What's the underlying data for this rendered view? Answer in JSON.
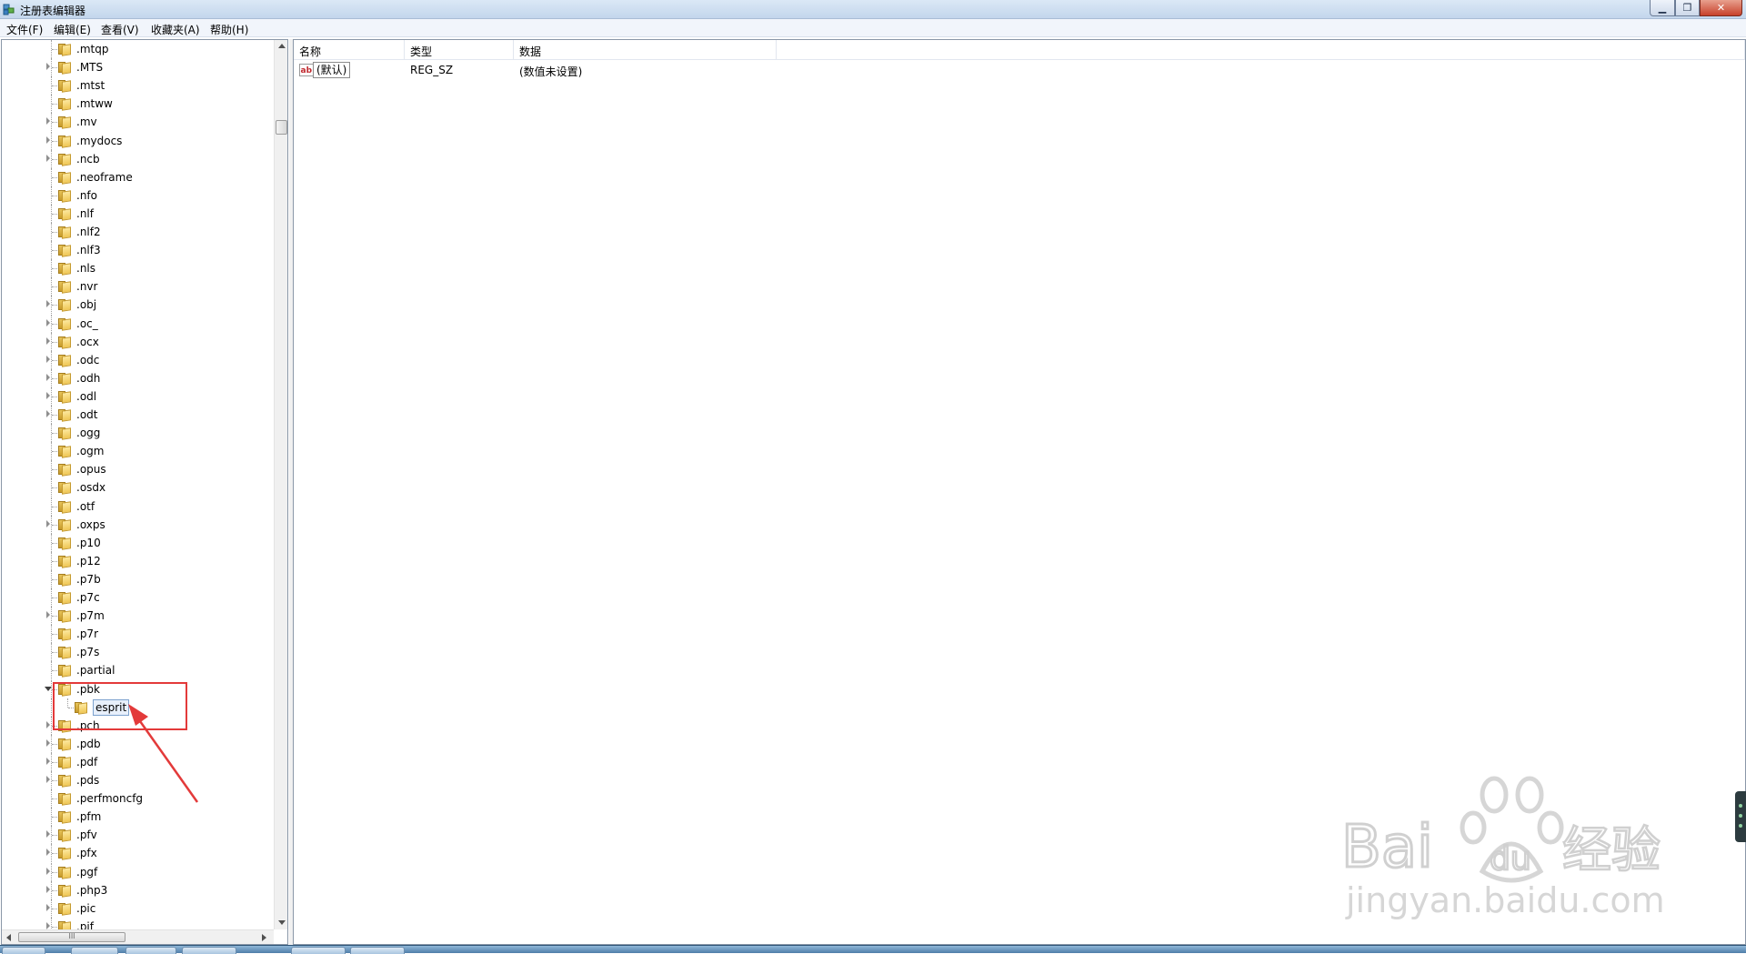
{
  "window": {
    "title": "注册表编辑器"
  },
  "menu": [
    "文件(F)",
    "编辑(E)",
    "查看(V)",
    "收藏夹(A)",
    "帮助(H)"
  ],
  "tree": {
    "items": [
      {
        "label": ".mtqp",
        "expander": false
      },
      {
        "label": ".MTS",
        "expander": true
      },
      {
        "label": ".mtst",
        "expander": false
      },
      {
        "label": ".mtww",
        "expander": false
      },
      {
        "label": ".mv",
        "expander": true
      },
      {
        "label": ".mydocs",
        "expander": true
      },
      {
        "label": ".ncb",
        "expander": true
      },
      {
        "label": ".neoframe",
        "expander": false
      },
      {
        "label": ".nfo",
        "expander": false
      },
      {
        "label": ".nlf",
        "expander": false
      },
      {
        "label": ".nlf2",
        "expander": false
      },
      {
        "label": ".nlf3",
        "expander": false
      },
      {
        "label": ".nls",
        "expander": false
      },
      {
        "label": ".nvr",
        "expander": false
      },
      {
        "label": ".obj",
        "expander": true
      },
      {
        "label": ".oc_",
        "expander": true
      },
      {
        "label": ".ocx",
        "expander": true
      },
      {
        "label": ".odc",
        "expander": true
      },
      {
        "label": ".odh",
        "expander": true
      },
      {
        "label": ".odl",
        "expander": true
      },
      {
        "label": ".odt",
        "expander": true
      },
      {
        "label": ".ogg",
        "expander": false
      },
      {
        "label": ".ogm",
        "expander": false
      },
      {
        "label": ".opus",
        "expander": false
      },
      {
        "label": ".osdx",
        "expander": false
      },
      {
        "label": ".otf",
        "expander": false
      },
      {
        "label": ".oxps",
        "expander": true
      },
      {
        "label": ".p10",
        "expander": false
      },
      {
        "label": ".p12",
        "expander": false
      },
      {
        "label": ".p7b",
        "expander": false
      },
      {
        "label": ".p7c",
        "expander": false
      },
      {
        "label": ".p7m",
        "expander": true
      },
      {
        "label": ".p7r",
        "expander": false
      },
      {
        "label": ".p7s",
        "expander": false
      },
      {
        "label": ".partial",
        "expander": false
      },
      {
        "label": ".pbk",
        "expander": "open"
      },
      {
        "label": "esprit",
        "expander": false,
        "child": true,
        "selected": true
      },
      {
        "label": ".pch",
        "expander": true
      },
      {
        "label": ".pdb",
        "expander": true
      },
      {
        "label": ".pdf",
        "expander": true
      },
      {
        "label": ".pds",
        "expander": true
      },
      {
        "label": ".perfmoncfg",
        "expander": false
      },
      {
        "label": ".pfm",
        "expander": false
      },
      {
        "label": ".pfv",
        "expander": true
      },
      {
        "label": ".pfx",
        "expander": true
      },
      {
        "label": ".pgf",
        "expander": true
      },
      {
        "label": ".php3",
        "expander": true
      },
      {
        "label": ".pic",
        "expander": true
      },
      {
        "label": ".pif",
        "expander": true
      }
    ],
    "hscroll_grip": "III"
  },
  "list": {
    "columns": [
      "名称",
      "类型",
      "数据"
    ],
    "rows": [
      {
        "icon": "string-value-icon",
        "icon_text": "ab",
        "name": "(默认)",
        "type": "REG_SZ",
        "data": "(数值未设置)"
      }
    ]
  },
  "watermark": {
    "brand": "Bai",
    "brand_du": "du",
    "brand_cn": "经验",
    "url": "jingyan.baidu.com"
  },
  "colors": {
    "annotation": "#e33a3a",
    "watermark": "#d6d6d6"
  }
}
